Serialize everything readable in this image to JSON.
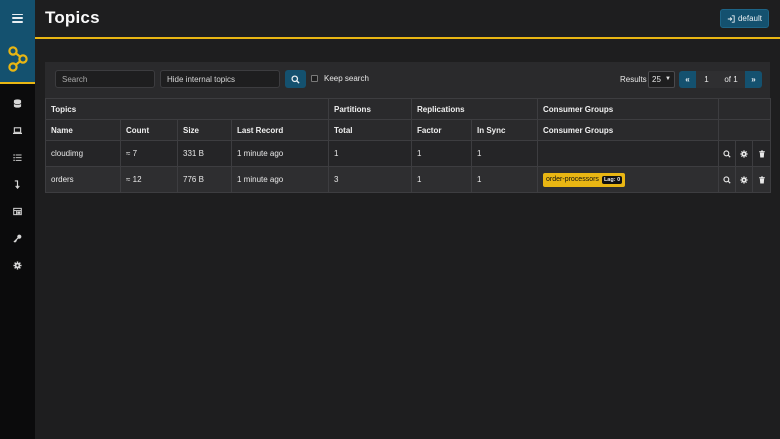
{
  "header": {
    "title": "Topics",
    "cluster_label": "default"
  },
  "toolbar": {
    "search_placeholder": "Search",
    "filter_value": "Hide internal topics",
    "keep_search_label": "Keep search",
    "results_label": "Results",
    "results_per_page": "25",
    "pager": {
      "first": "«",
      "current": "1",
      "of": "of 1",
      "last": "»"
    }
  },
  "table": {
    "group_headers": [
      "Topics",
      "Partitions",
      "Replications",
      "Consumer Groups"
    ],
    "columns": [
      "Name",
      "Count",
      "Size",
      "Last Record",
      "Total",
      "Factor",
      "In Sync",
      "Consumer Groups"
    ],
    "rows": [
      {
        "name": "cloudimg",
        "count": "≈ 7",
        "size": "331 B",
        "last_record": "1 minute ago",
        "total": "1",
        "factor": "1",
        "in_sync": "1",
        "consumer_groups": []
      },
      {
        "name": "orders",
        "count": "≈ 12",
        "size": "776 B",
        "last_record": "1 minute ago",
        "total": "3",
        "factor": "1",
        "in_sync": "1",
        "consumer_groups": [
          {
            "name": "order-processors",
            "lag": "Lag: 0"
          }
        ]
      }
    ]
  },
  "colors": {
    "accent": "#e9b613",
    "primary": "#14516f",
    "background": "#1e1e1f",
    "sidebar": "#0b0b0c",
    "panel": "#2a2a2c"
  },
  "icons": {
    "sidebar": [
      "database-icon",
      "laptop-icon",
      "list-icon",
      "level-down-icon",
      "table-icon",
      "key-icon",
      "gear-icon"
    ],
    "row_actions": [
      "search-icon",
      "gear-icon",
      "trash-icon"
    ]
  }
}
